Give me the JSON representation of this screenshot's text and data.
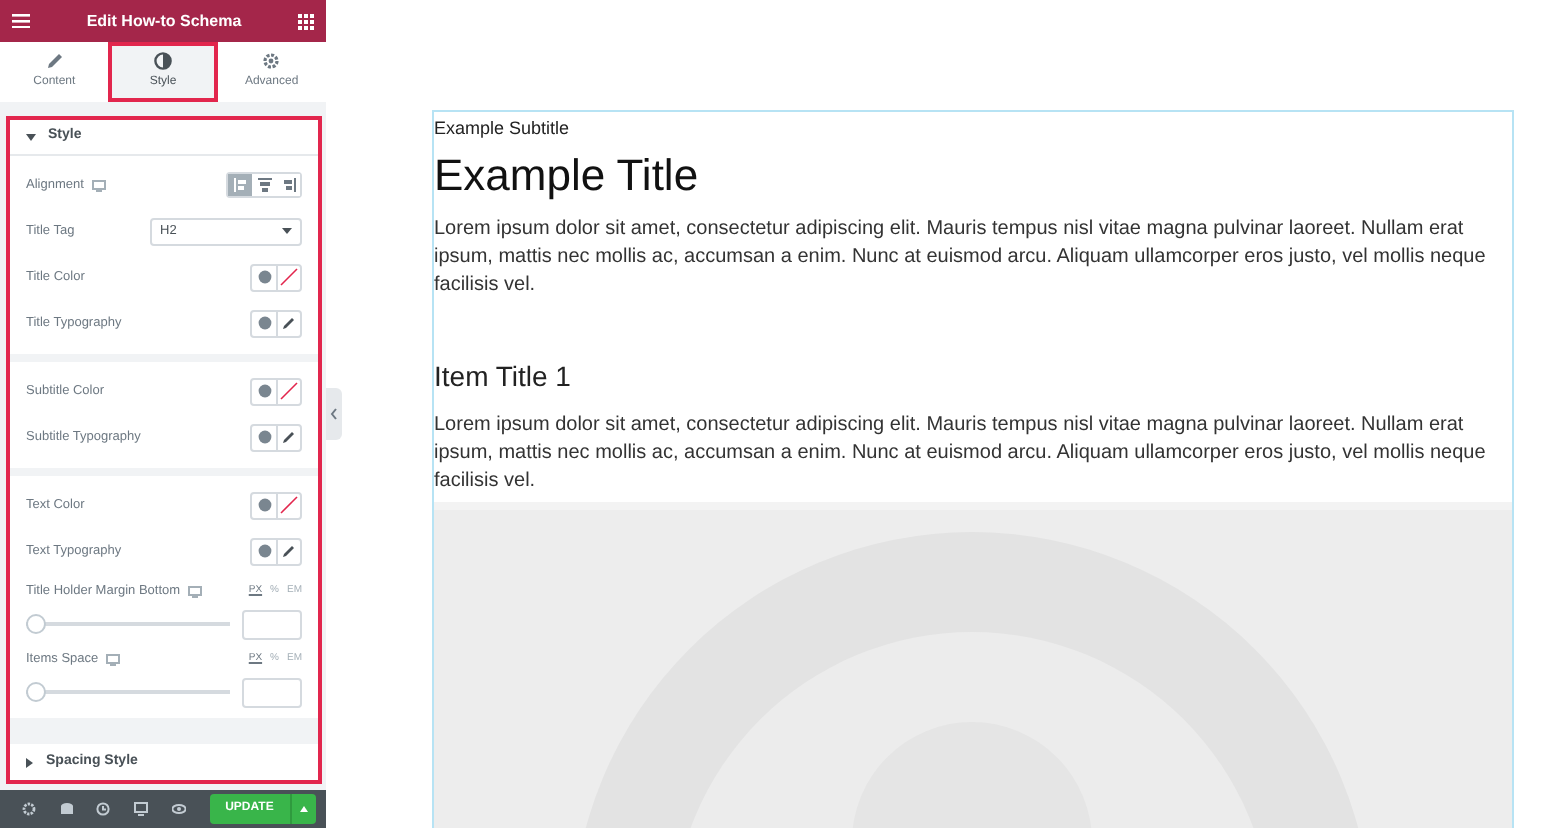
{
  "header": {
    "title": "Edit How-to Schema"
  },
  "tabs": [
    {
      "label": "Content",
      "selected": false,
      "highlighted": false
    },
    {
      "label": "Style",
      "selected": true,
      "highlighted": true
    },
    {
      "label": "Advanced",
      "selected": false,
      "highlighted": false
    }
  ],
  "panel": {
    "highlighted": true,
    "sections": [
      {
        "title": "Style",
        "expanded": true,
        "groups": [
          [
            {
              "kind": "choose",
              "label": "Alignment",
              "responsive": true,
              "options": [
                {
                  "selected": true
                },
                {
                  "selected": false
                },
                {
                  "selected": false
                }
              ]
            },
            {
              "kind": "select",
              "label": "Title Tag",
              "value": "H2"
            },
            {
              "kind": "color",
              "label": "Title Color"
            },
            {
              "kind": "typography",
              "label": "Title Typography"
            }
          ],
          [
            {
              "kind": "color",
              "label": "Subtitle Color"
            },
            {
              "kind": "typography",
              "label": "Subtitle Typography"
            }
          ],
          [
            {
              "kind": "color",
              "label": "Text Color"
            },
            {
              "kind": "typography",
              "label": "Text Typography"
            },
            {
              "kind": "slider",
              "label": "Title Holder Margin Bottom",
              "responsive": true,
              "level": 0,
              "units": [
                {
                  "label": "PX",
                  "selected": true
                },
                {
                  "label": "%",
                  "selected": false
                },
                {
                  "label": "EM",
                  "selected": false
                }
              ]
            },
            {
              "kind": "slider",
              "label": "Items Space",
              "responsive": true,
              "level": 0,
              "units": [
                {
                  "label": "PX",
                  "selected": true
                },
                {
                  "label": "%",
                  "selected": false
                },
                {
                  "label": "EM",
                  "selected": false
                }
              ]
            }
          ]
        ]
      },
      {
        "title": "Spacing Style",
        "expanded": false
      }
    ]
  },
  "footer": {
    "update": "UPDATE"
  },
  "preview": {
    "subtitle": "Example Subtitle",
    "title": "Example Title",
    "text": "Lorem ipsum dolor sit amet, consectetur adipiscing elit. Mauris tempus nisl vitae magna pulvinar laoreet. Nullam erat ipsum, mattis nec mollis ac, accumsan a enim. Nunc at euismod arcu. Aliquam ullamcorper eros justo, vel mollis neque facilisis vel.",
    "items": [
      {
        "title": "Item Title 1",
        "text": "Lorem ipsum dolor sit amet, consectetur adipiscing elit. Mauris tempus nisl vitae magna pulvinar laoreet. Nullam erat ipsum, mattis nec mollis ac, accumsan a enim. Nunc at euismod arcu. Aliquam ullamcorper eros justo, vel mollis neque facilisis vel."
      }
    ]
  }
}
